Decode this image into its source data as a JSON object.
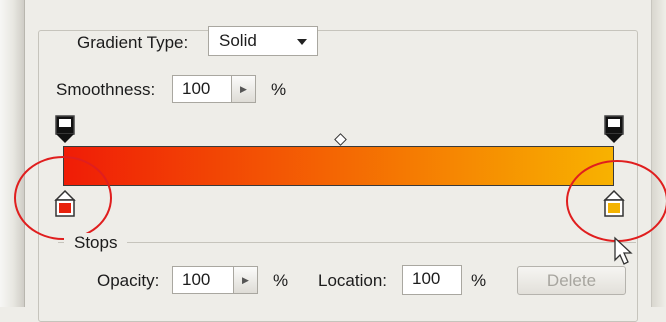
{
  "gradient_editor": {
    "gradient_type_label": "Gradient Type:",
    "gradient_type_value": "Solid",
    "smoothness_label": "Smoothness:",
    "smoothness_value": "100",
    "smoothness_unit": "%",
    "gradient": {
      "start_color": "#f01c06",
      "end_color": "#f8b200",
      "midpoint_fraction": 0.5
    },
    "opacity_stops": [
      {
        "location_percent": 0,
        "color": "#111111"
      },
      {
        "location_percent": 100,
        "color": "#111111"
      }
    ],
    "color_stops": [
      {
        "location_percent": 0,
        "color": "#e8210c"
      },
      {
        "location_percent": 100,
        "color": "#f4b300"
      }
    ],
    "stops_group_label": "Stops",
    "opacity_label": "Opacity:",
    "opacity_value": "100",
    "opacity_unit": "%",
    "location_label": "Location:",
    "location_value": "100",
    "location_unit": "%",
    "delete_label": "Delete"
  },
  "highlight_color": "#e01e1e",
  "icons": [
    "opacity-stop-icon",
    "color-stop-icon",
    "midpoint-diamond-icon",
    "stepper-arrow-icon",
    "dropdown-arrow-icon",
    "mouse-cursor-icon"
  ]
}
